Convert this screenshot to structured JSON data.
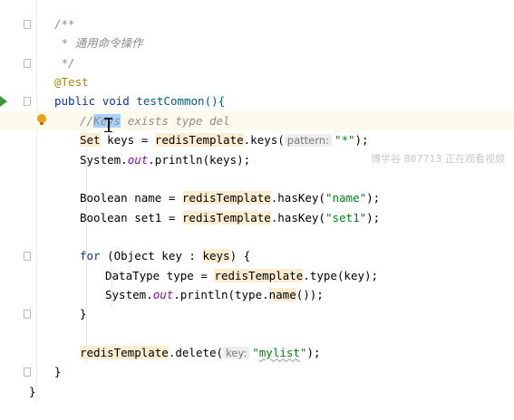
{
  "editor": {
    "watermark": "博学谷 887713 正在观看视频",
    "lines": {
      "doc_open": "/**",
      "doc_text": " * 通用命令操作",
      "doc_close": " */",
      "annotation": "@Test",
      "sig_public": "public",
      "sig_void": "void",
      "sig_name": "testCommon(){",
      "comment_prefix": "//",
      "comment_sel": "Keys",
      "comment_rest": " exists type del",
      "l1_type": "Set",
      "l1_var": " keys = ",
      "l1_bean": "redisTemplate",
      "l1_call": ".keys(",
      "l1_hint": "pattern:",
      "l1_arg": "\"*\"",
      "l1_end": ");",
      "l2_a": "System.",
      "l2_out": "out",
      "l2_b": ".println(keys);",
      "l3_type": "Boolean",
      "l3_var": " name = ",
      "l3_bean": "redisTemplate",
      "l3_call": ".hasKey(",
      "l3_arg": "\"name\"",
      "l3_end": ");",
      "l4_type": "Boolean",
      "l4_var": " set1 = ",
      "l4_bean": "redisTemplate",
      "l4_call": ".hasKey(",
      "l4_arg": "\"set1\"",
      "l4_end": ");",
      "for_kw": "for",
      "for_open": " (Object key : ",
      "for_keys": "keys",
      "for_close": ") {",
      "l5_a": "DataType type = ",
      "l5_bean": "redisTemplate",
      "l5_call": ".type(key);",
      "l6_a": "System.",
      "l6_out": "out",
      "l6_b": ".println(type.",
      "l6_name": "name",
      "l6_c": "());",
      "for_end": "}",
      "l7_bean": "redisTemplate",
      "l7_call": ".delete(",
      "l7_hint": "key:",
      "l7_q1": "\"",
      "l7_arg": "mylist",
      "l7_q2": "\"",
      "l7_end": ");",
      "method_end": "}",
      "class_end": "}"
    }
  }
}
